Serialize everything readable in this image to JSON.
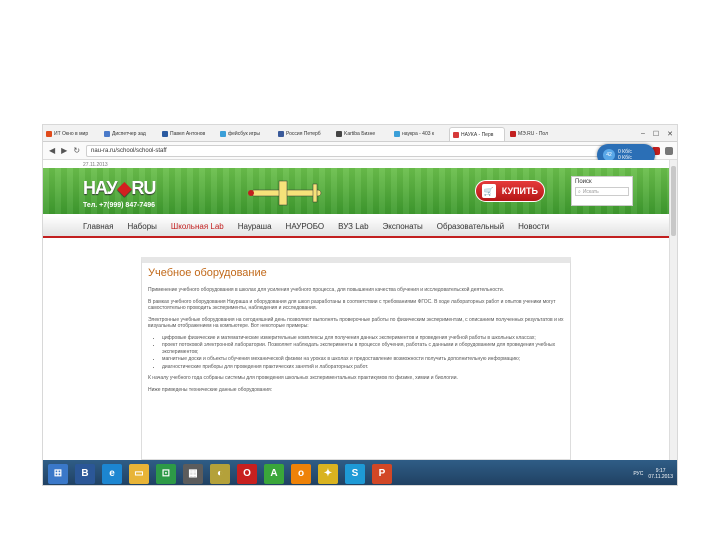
{
  "browser": {
    "tabs": [
      {
        "label": "ИТ Окно в мир",
        "color": "#e04a1a"
      },
      {
        "label": "Диспетчер зад",
        "color": "#4a7ac9"
      },
      {
        "label": "Павел Антонов",
        "color": "#2a5aa0"
      },
      {
        "label": "фейсбук игры",
        "color": "#3b9fd8"
      },
      {
        "label": "Россия Петерб",
        "color": "#3a5a9a"
      },
      {
        "label": "Kartiba Бизне",
        "color": "#444444"
      },
      {
        "label": "наукра - 403 к",
        "color": "#3b9fd8"
      },
      {
        "label": "НАУКА - Перв",
        "color": "#d63a3a"
      },
      {
        "label": "МЭ.RU - Пол",
        "color": "#c21f1f"
      }
    ],
    "window_controls": [
      "–",
      "☐",
      "✕"
    ],
    "url": "nau-ra.ru/school/school-staff",
    "nav_icons": [
      "back-icon",
      "forward-icon",
      "reload-icon"
    ],
    "bubble_value": "42",
    "bubble_text": "0 Кб/с\n0 Кб/с"
  },
  "site": {
    "date": "27.11.2013",
    "logo_left": "НАУ",
    "logo_right": "RU",
    "phone": "Тел. +7(999) 847-7496",
    "buy_label": "КУПИТЬ",
    "search_label": "Поиск",
    "search_placeholder": "Искать",
    "nav": [
      "Главная",
      "Наборы",
      "Школьная Lab",
      "Наураша",
      "НАУРОБО",
      "ВУЗ Lab",
      "Экспонаты",
      "Образовательный",
      "Новости"
    ],
    "nav_current": "Школьная Lab"
  },
  "content": {
    "title": "Учебное оборудование",
    "p1": "Применение учебного оборудования в школах для усиления учебного процесса, для повышения качества обучения и исследовательской деятельности.",
    "p2": "В рамках учебного оборудования Наураша и оборудования для школ разработаны в соответствии с требованиями ФГОС. В ходе лабораторных работ и опытов ученики могут самостоятельно проводить эксперименты, наблюдения и исследования.",
    "p3": "Электронные учебные оборудования на сегодняшний день позволяют выполнять проверочные работы по физическим экспериментам, с описанием полученных результатов и их визуальным отображением на компьютере. Вот некоторые примеры:",
    "bullets": [
      "цифровые физические и математические измерительные комплексы для получения данных экспериментов и проведения учебной работы в школьных классах;",
      "проект потоковой электронной лаборатории. Позволяет наблюдать эксперименты в процессе обучения, работать с данными и оборудованием для проведения учебных экспериментов;",
      "магнитные доски и объекты обучения механической физики на уроках в школах и предоставление возможности получить дополнительную информацию;",
      "диагностические приборы для проведения практических занятий и лабораторных работ."
    ],
    "p4": "К началу учебного года собраны системы для проведения школьных экспериментальных практикумов по физике, химии и биологии.",
    "p5": "Ниже приведены технические данные оборудования:"
  },
  "taskbar": {
    "apps": [
      {
        "name": "windows-start-icon",
        "glyph": "⊞",
        "color": "#3a78c9"
      },
      {
        "name": "b-app-icon",
        "glyph": "B",
        "color": "#2b5797"
      },
      {
        "name": "ie-icon",
        "glyph": "e",
        "color": "#1c86d1"
      },
      {
        "name": "folder-icon",
        "glyph": "▭",
        "color": "#e8b437"
      },
      {
        "name": "store-icon",
        "glyph": "⊡",
        "color": "#2d9a47"
      },
      {
        "name": "photos-icon",
        "glyph": "▦",
        "color": "#5c5c5c"
      },
      {
        "name": "paint-icon",
        "glyph": "◐",
        "color": "#b4a13a"
      },
      {
        "name": "opera-icon",
        "glyph": "O",
        "color": "#c8201f"
      },
      {
        "name": "adobe-icon",
        "glyph": "A",
        "color": "#3aa63a"
      },
      {
        "name": "odnoklassniki-icon",
        "glyph": "о",
        "color": "#ee8208"
      },
      {
        "name": "chart-app-icon",
        "glyph": "✦",
        "color": "#d9b320"
      },
      {
        "name": "skype-icon",
        "glyph": "S",
        "color": "#1e9ad6"
      },
      {
        "name": "powerpoint-icon",
        "glyph": "P",
        "color": "#d24726"
      }
    ],
    "lang": "РУС",
    "time": "9:17",
    "date": "07.11.2013"
  }
}
